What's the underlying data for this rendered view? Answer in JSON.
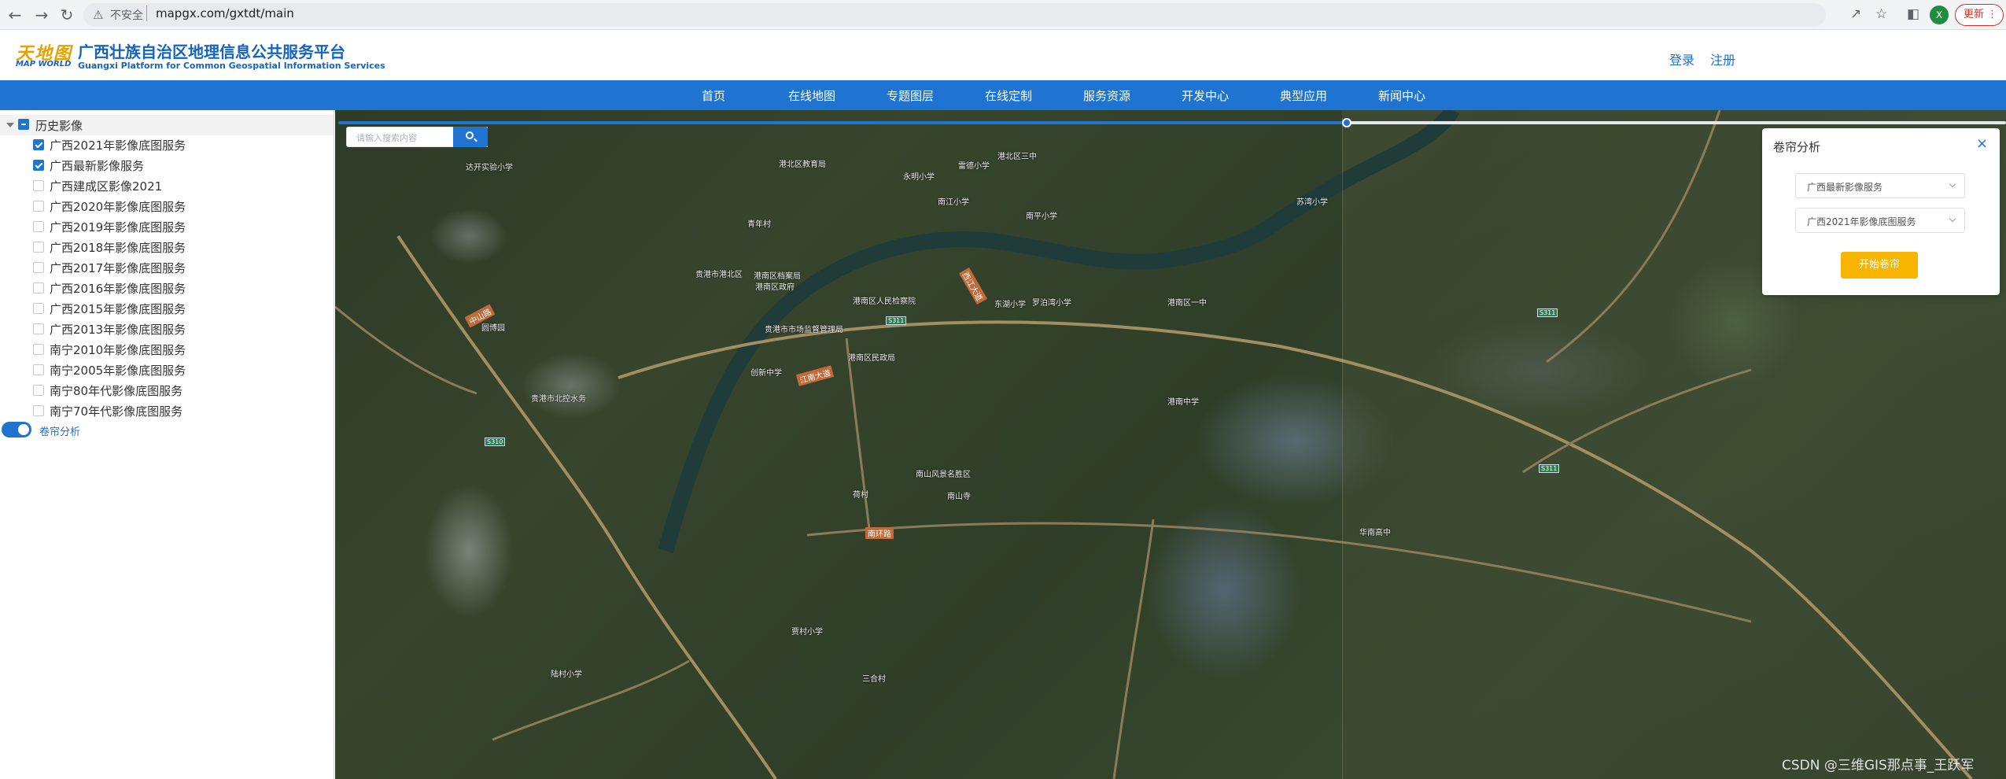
{
  "browser": {
    "insecure_label": "不安全",
    "url": "mapgx.com/gxtdt/main",
    "update_label": "更新",
    "profile_initial": "X"
  },
  "header": {
    "logo_top": "天地图",
    "logo_bottom": "MAP WORLD",
    "title": "广西壮族自治区地理信息公共服务平台",
    "subtitle": "Guangxi Platform for Common Geospatial Information Services",
    "login": "登录",
    "register": "注册"
  },
  "nav": {
    "items": [
      "首页",
      "在线地图",
      "专题图层",
      "在线定制",
      "服务资源",
      "开发中心",
      "典型应用",
      "新闻中心"
    ]
  },
  "sidebar": {
    "root_label": "历史影像",
    "items": [
      {
        "label": "广西2021年影像底图服务",
        "checked": true
      },
      {
        "label": "广西最新影像服务",
        "checked": true
      },
      {
        "label": "广西建成区影像2021",
        "checked": false
      },
      {
        "label": "广西2020年影像底图服务",
        "checked": false
      },
      {
        "label": "广西2019年影像底图服务",
        "checked": false
      },
      {
        "label": "广西2018年影像底图服务",
        "checked": false
      },
      {
        "label": "广西2017年影像底图服务",
        "checked": false
      },
      {
        "label": "广西2016年影像底图服务",
        "checked": false
      },
      {
        "label": "广西2015年影像底图服务",
        "checked": false
      },
      {
        "label": "广西2013年影像底图服务",
        "checked": false
      },
      {
        "label": "南宁2010年影像底图服务",
        "checked": false
      },
      {
        "label": "南宁2005年影像底图服务",
        "checked": false
      },
      {
        "label": "南宁80年代影像底图服务",
        "checked": false
      },
      {
        "label": "南宁70年代影像底图服务",
        "checked": false
      }
    ],
    "swipe_toggle_label": "卷帘分析"
  },
  "map": {
    "search_placeholder": "请输入搜索内容",
    "swipe_position": 0.605,
    "labels": [
      "达开实验小学",
      "港北区教育局",
      "永明小学",
      "雷德小学",
      "港北区三中",
      "青年村",
      "南平小学",
      "苏湾小学",
      "南江小学",
      "贵港市港北区",
      "港南区档案局",
      "港南区政府",
      "港南区人民检察院",
      "贵港市市场监督管理局",
      "港南区民政局",
      "罗泊湾小学",
      "港南区一中",
      "创新中学",
      "圆博园",
      "贵港市北控水务",
      "港南中学",
      "华南高中",
      "南山风景名胜区",
      "南山寺",
      "东湖小学",
      "贾村小学",
      "陆村小学",
      "荷村",
      "三合村"
    ],
    "roads": [
      "中山路",
      "江南大道",
      "南环路",
      "西江大道"
    ],
    "shields": [
      "S311",
      "S310",
      "S311",
      "S311"
    ]
  },
  "panel": {
    "title": "卷帘分析",
    "close": "×",
    "select_left": "广西最新影像服务",
    "select_right": "广西2021年影像底图服务",
    "start_button": "开始卷帘"
  },
  "watermark": "CSDN @三维GIS那点事_王跃军",
  "colors": {
    "brand_blue": "#1f74d2",
    "accent_orange": "#f7b500",
    "update_red": "#d93025"
  }
}
